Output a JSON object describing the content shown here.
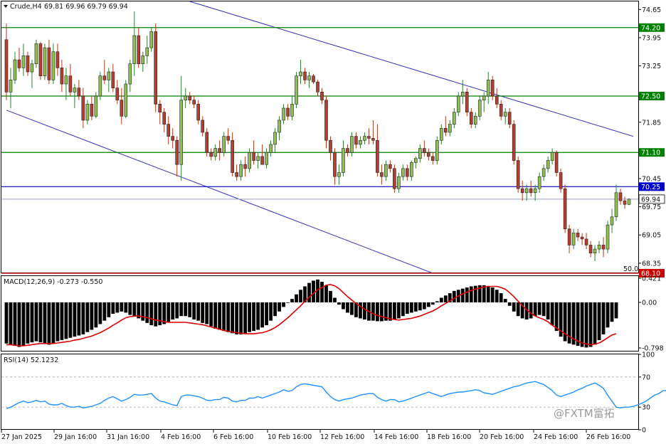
{
  "chart_data": {
    "type": "candlestick",
    "header": {
      "symbol_timeframe": "Crude,H4",
      "ohlc_text": "69.81 69.96 69.79 69.94"
    },
    "price_axis": {
      "ylim": [
        68.1,
        74.85
      ],
      "ticks": [
        "74.65",
        "73.95",
        "73.25",
        "72.50",
        "71.85",
        "71.10",
        "70.45",
        "69.75",
        "69.05",
        "68.35"
      ],
      "tick_values": [
        74.65,
        73.95,
        73.25,
        72.5,
        71.85,
        71.1,
        70.45,
        69.75,
        69.05,
        68.35
      ]
    },
    "x_labels": [
      "27 Jan 2025",
      "29 Jan 16:00",
      "31 Jan 16:00",
      "4 Feb 16:00",
      "6 Feb 16:00",
      "10 Feb 16:00",
      "12 Feb 16:00",
      "14 Feb 16:00",
      "18 Feb 16:00",
      "20 Feb 16:00",
      "24 Feb 16:00",
      "26 Feb 16:00"
    ],
    "levels": [
      {
        "value": 74.2,
        "label": "74.20",
        "color": "#008000"
      },
      {
        "value": 72.5,
        "label": "72.50",
        "color": "#008000"
      },
      {
        "value": 71.1,
        "label": "71.10",
        "color": "#008000"
      },
      {
        "value": 70.25,
        "label": "70.25",
        "color": "#0000cd"
      },
      {
        "value": 68.1,
        "label": "68.10",
        "color": "#cc0000"
      }
    ],
    "current_price": {
      "value": 69.94,
      "label": "69.94"
    },
    "fib_label": "50.0",
    "channel": {
      "color": "#3333bb",
      "upper": [
        [
          43,
          74.85
        ],
        [
          147,
          71.5
        ]
      ],
      "lower": [
        [
          0,
          72.15
        ],
        [
          100,
          68.1
        ]
      ]
    },
    "colors": {
      "up": "#2e7d32",
      "down": "#b23a1a",
      "bull_body": "#8bc34a",
      "bear_body": "#c0392b",
      "macd_bar": "#000000",
      "signal": "#dd0000",
      "rsi": "#1e90ff"
    },
    "candles": [
      [
        73.9,
        74.3,
        72.4,
        72.6
      ],
      [
        72.6,
        73.2,
        72.2,
        72.9
      ],
      [
        72.9,
        73.6,
        72.8,
        73.4
      ],
      [
        73.4,
        73.7,
        73.1,
        73.2
      ],
      [
        73.2,
        73.8,
        73.0,
        73.5
      ],
      [
        73.5,
        73.6,
        73.0,
        73.1
      ],
      [
        73.1,
        73.4,
        72.7,
        73.3
      ],
      [
        73.3,
        73.9,
        73.2,
        73.8
      ],
      [
        73.8,
        73.85,
        72.9,
        73.0
      ],
      [
        73.0,
        73.8,
        72.9,
        73.7
      ],
      [
        73.7,
        73.9,
        72.8,
        72.9
      ],
      [
        72.9,
        73.8,
        72.8,
        73.6
      ],
      [
        73.6,
        73.8,
        73.0,
        73.2
      ],
      [
        73.2,
        73.4,
        72.6,
        72.8
      ],
      [
        72.8,
        73.2,
        72.4,
        73.0
      ],
      [
        73.0,
        73.3,
        72.5,
        72.6
      ],
      [
        72.6,
        72.8,
        72.2,
        72.7
      ],
      [
        72.7,
        72.9,
        72.4,
        72.5
      ],
      [
        72.5,
        72.7,
        71.7,
        71.9
      ],
      [
        71.9,
        72.4,
        71.8,
        72.3
      ],
      [
        72.3,
        72.5,
        71.9,
        72.0
      ],
      [
        72.0,
        72.6,
        71.95,
        72.5
      ],
      [
        72.5,
        73.1,
        72.4,
        73.0
      ],
      [
        73.0,
        73.4,
        72.8,
        72.9
      ],
      [
        72.9,
        73.2,
        72.6,
        73.1
      ],
      [
        73.1,
        73.3,
        72.6,
        72.7
      ],
      [
        72.7,
        72.9,
        72.3,
        72.4
      ],
      [
        72.4,
        72.7,
        71.8,
        72.0
      ],
      [
        72.0,
        72.9,
        71.95,
        72.8
      ],
      [
        72.8,
        73.4,
        72.6,
        73.3
      ],
      [
        73.3,
        74.6,
        73.0,
        74.0
      ],
      [
        74.0,
        74.2,
        73.2,
        73.3
      ],
      [
        73.3,
        73.6,
        73.1,
        73.5
      ],
      [
        73.5,
        74.0,
        73.3,
        73.7
      ],
      [
        73.7,
        74.2,
        73.6,
        74.1
      ],
      [
        74.1,
        74.3,
        72.1,
        72.3
      ],
      [
        72.3,
        72.4,
        71.8,
        72.1
      ],
      [
        72.1,
        72.2,
        71.6,
        71.8
      ],
      [
        71.8,
        72.0,
        71.3,
        71.5
      ],
      [
        71.5,
        71.7,
        71.2,
        71.4
      ],
      [
        71.4,
        71.5,
        70.5,
        70.8
      ],
      [
        70.8,
        73.0,
        70.4,
        72.4
      ],
      [
        72.4,
        72.7,
        72.2,
        72.5
      ],
      [
        72.5,
        72.6,
        72.3,
        72.4
      ],
      [
        72.4,
        72.5,
        72.2,
        72.3
      ],
      [
        72.3,
        72.4,
        71.8,
        71.9
      ],
      [
        71.9,
        72.0,
        71.5,
        71.6
      ],
      [
        71.6,
        71.7,
        71.0,
        71.1
      ],
      [
        71.1,
        71.2,
        70.9,
        71.0
      ],
      [
        71.0,
        71.3,
        70.9,
        71.2
      ],
      [
        71.2,
        71.4,
        70.9,
        71.1
      ],
      [
        71.1,
        71.6,
        71.0,
        71.5
      ],
      [
        71.5,
        71.7,
        71.3,
        71.4
      ],
      [
        71.4,
        71.6,
        70.5,
        70.6
      ],
      [
        70.6,
        70.8,
        70.4,
        70.5
      ],
      [
        70.5,
        70.9,
        70.4,
        70.8
      ],
      [
        70.8,
        71.0,
        70.5,
        70.7
      ],
      [
        70.7,
        71.2,
        70.6,
        71.1
      ],
      [
        71.1,
        71.4,
        70.8,
        70.9
      ],
      [
        70.9,
        71.1,
        70.7,
        71.0
      ],
      [
        71.0,
        71.3,
        70.9,
        70.8
      ],
      [
        70.8,
        71.2,
        70.7,
        71.1
      ],
      [
        71.1,
        71.4,
        71.0,
        71.3
      ],
      [
        71.3,
        71.7,
        71.1,
        71.6
      ],
      [
        71.6,
        72.0,
        71.4,
        71.9
      ],
      [
        71.9,
        72.3,
        71.8,
        72.2
      ],
      [
        72.2,
        72.3,
        71.9,
        72.0
      ],
      [
        72.0,
        72.5,
        71.9,
        72.3
      ],
      [
        72.3,
        73.1,
        72.2,
        73.0
      ],
      [
        73.0,
        73.4,
        72.8,
        73.1
      ],
      [
        73.1,
        73.2,
        72.8,
        72.9
      ],
      [
        72.9,
        73.1,
        72.7,
        73.0
      ],
      [
        73.0,
        73.05,
        72.8,
        72.85
      ],
      [
        72.85,
        72.9,
        72.5,
        72.6
      ],
      [
        72.6,
        72.7,
        72.3,
        72.4
      ],
      [
        72.4,
        72.5,
        71.2,
        71.4
      ],
      [
        71.4,
        71.5,
        70.9,
        71.1
      ],
      [
        71.1,
        71.2,
        70.3,
        70.5
      ],
      [
        70.5,
        70.8,
        70.3,
        70.6
      ],
      [
        70.6,
        71.4,
        70.5,
        71.2
      ],
      [
        71.2,
        71.3,
        71.0,
        71.1
      ],
      [
        71.1,
        71.6,
        71.0,
        71.5
      ],
      [
        71.5,
        71.6,
        71.2,
        71.3
      ],
      [
        71.3,
        71.5,
        71.2,
        71.4
      ],
      [
        71.4,
        71.6,
        71.3,
        71.5
      ],
      [
        71.5,
        71.7,
        71.3,
        71.45
      ],
      [
        71.45,
        71.9,
        71.3,
        71.4
      ],
      [
        71.4,
        71.8,
        70.5,
        70.6
      ],
      [
        70.6,
        70.8,
        70.3,
        70.5
      ],
      [
        70.5,
        70.9,
        70.4,
        70.8
      ],
      [
        70.8,
        70.9,
        70.6,
        70.7
      ],
      [
        70.7,
        70.8,
        70.1,
        70.2
      ],
      [
        70.2,
        70.6,
        70.1,
        70.5
      ],
      [
        70.5,
        70.8,
        70.4,
        70.7
      ],
      [
        70.7,
        70.8,
        70.4,
        70.5
      ],
      [
        70.5,
        70.9,
        70.4,
        70.85
      ],
      [
        70.85,
        71.0,
        70.7,
        70.95
      ],
      [
        70.95,
        71.3,
        70.85,
        71.2
      ],
      [
        71.2,
        71.4,
        71.0,
        71.1
      ],
      [
        71.1,
        71.2,
        70.9,
        71.0
      ],
      [
        71.0,
        71.1,
        70.8,
        70.9
      ],
      [
        70.9,
        71.5,
        70.8,
        71.4
      ],
      [
        71.4,
        71.8,
        71.3,
        71.7
      ],
      [
        71.7,
        72.0,
        71.5,
        71.6
      ],
      [
        71.6,
        71.9,
        71.5,
        71.8
      ],
      [
        71.8,
        72.2,
        71.7,
        72.1
      ],
      [
        72.1,
        72.6,
        72.0,
        72.5
      ],
      [
        72.5,
        72.9,
        72.3,
        72.6
      ],
      [
        72.6,
        72.7,
        72.0,
        72.1
      ],
      [
        72.1,
        72.2,
        71.7,
        71.8
      ],
      [
        71.8,
        72.1,
        71.7,
        72.0
      ],
      [
        72.0,
        72.5,
        71.9,
        72.4
      ],
      [
        72.4,
        72.6,
        72.1,
        72.5
      ],
      [
        72.5,
        73.1,
        72.3,
        72.9
      ],
      [
        72.9,
        73.0,
        72.4,
        72.5
      ],
      [
        72.5,
        72.7,
        72.2,
        72.3
      ],
      [
        72.3,
        72.4,
        71.9,
        72.0
      ],
      [
        72.0,
        72.2,
        71.8,
        72.1
      ],
      [
        72.1,
        72.2,
        71.7,
        71.8
      ],
      [
        71.8,
        71.9,
        70.8,
        70.9
      ],
      [
        70.9,
        71.0,
        70.1,
        70.2
      ],
      [
        70.2,
        70.4,
        69.9,
        70.1
      ],
      [
        70.1,
        70.3,
        69.9,
        70.2
      ],
      [
        70.2,
        70.4,
        70.0,
        70.1
      ],
      [
        70.1,
        70.3,
        69.9,
        70.2
      ],
      [
        70.2,
        70.6,
        70.1,
        70.5
      ],
      [
        70.5,
        70.8,
        70.4,
        70.7
      ],
      [
        70.7,
        71.0,
        70.6,
        70.9
      ],
      [
        70.9,
        71.2,
        70.8,
        71.1
      ],
      [
        71.1,
        71.15,
        70.5,
        70.6
      ],
      [
        70.6,
        70.7,
        70.1,
        70.2
      ],
      [
        70.2,
        70.3,
        69.1,
        69.2
      ],
      [
        69.2,
        69.3,
        68.6,
        68.8
      ],
      [
        68.8,
        69.2,
        68.7,
        69.1
      ],
      [
        69.1,
        69.2,
        68.9,
        69.0
      ],
      [
        69.0,
        69.1,
        68.8,
        68.95
      ],
      [
        68.95,
        69.1,
        68.7,
        68.8
      ],
      [
        68.8,
        68.9,
        68.5,
        68.6
      ],
      [
        68.6,
        68.8,
        68.4,
        68.7
      ],
      [
        68.7,
        68.9,
        68.6,
        68.8
      ],
      [
        68.8,
        69.0,
        68.5,
        68.7
      ],
      [
        68.7,
        69.4,
        68.6,
        69.3
      ],
      [
        69.3,
        69.7,
        69.1,
        69.5
      ],
      [
        69.5,
        70.3,
        69.4,
        70.1
      ],
      [
        70.1,
        70.2,
        69.8,
        69.9
      ],
      [
        69.9,
        70.0,
        69.7,
        69.81
      ],
      [
        69.81,
        69.96,
        69.79,
        69.94
      ]
    ],
    "macd": {
      "label": "MACD(12,26,9) -0.273 -0.550",
      "ylim": [
        -0.86,
        0.46
      ],
      "ticks": [
        "0.421",
        "0.00",
        "-0.798"
      ],
      "tick_values": [
        0.421,
        0,
        -0.798
      ],
      "bars": [
        -0.72,
        -0.74,
        -0.76,
        -0.78,
        -0.76,
        -0.72,
        -0.7,
        -0.68,
        -0.7,
        -0.72,
        -0.74,
        -0.72,
        -0.68,
        -0.66,
        -0.64,
        -0.62,
        -0.6,
        -0.58,
        -0.56,
        -0.52,
        -0.48,
        -0.44,
        -0.38,
        -0.32,
        -0.26,
        -0.2,
        -0.18,
        -0.16,
        -0.18,
        -0.22,
        -0.24,
        -0.28,
        -0.32,
        -0.36,
        -0.4,
        -0.42,
        -0.4,
        -0.38,
        -0.34,
        -0.3,
        -0.28,
        -0.24,
        -0.24,
        -0.26,
        -0.3,
        -0.32,
        -0.36,
        -0.38,
        -0.42,
        -0.46,
        -0.48,
        -0.5,
        -0.52,
        -0.54,
        -0.56,
        -0.56,
        -0.54,
        -0.52,
        -0.5,
        -0.48,
        -0.44,
        -0.4,
        -0.32,
        -0.24,
        -0.16,
        -0.08,
        0.0,
        0.06,
        0.14,
        0.22,
        0.28,
        0.34,
        0.38,
        0.4,
        0.36,
        0.3,
        0.2,
        0.08,
        -0.04,
        -0.12,
        -0.18,
        -0.22,
        -0.26,
        -0.28,
        -0.3,
        -0.32,
        -0.32,
        -0.33,
        -0.33,
        -0.32,
        -0.32,
        -0.3,
        -0.28,
        -0.24,
        -0.2,
        -0.18,
        -0.16,
        -0.14,
        -0.12,
        -0.08,
        -0.04,
        0.02,
        0.08,
        0.12,
        0.16,
        0.2,
        0.22,
        0.24,
        0.26,
        0.28,
        0.29,
        0.3,
        0.3,
        0.28,
        0.26,
        0.22,
        0.16,
        0.06,
        -0.06,
        -0.16,
        -0.24,
        -0.28,
        -0.3,
        -0.28,
        -0.24,
        -0.22,
        -0.24,
        -0.3,
        -0.4,
        -0.5,
        -0.6,
        -0.68,
        -0.72,
        -0.74,
        -0.76,
        -0.78,
        -0.79,
        -0.78,
        -0.74,
        -0.66,
        -0.56,
        -0.44,
        -0.34,
        -0.28
      ],
      "signal": [
        -0.74,
        -0.74,
        -0.75,
        -0.76,
        -0.76,
        -0.75,
        -0.74,
        -0.73,
        -0.72,
        -0.72,
        -0.72,
        -0.72,
        -0.71,
        -0.7,
        -0.69,
        -0.68,
        -0.66,
        -0.65,
        -0.63,
        -0.61,
        -0.59,
        -0.56,
        -0.53,
        -0.49,
        -0.45,
        -0.4,
        -0.36,
        -0.31,
        -0.27,
        -0.25,
        -0.24,
        -0.24,
        -0.25,
        -0.27,
        -0.29,
        -0.31,
        -0.32,
        -0.34,
        -0.35,
        -0.35,
        -0.35,
        -0.35,
        -0.35,
        -0.36,
        -0.37,
        -0.38,
        -0.39,
        -0.41,
        -0.43,
        -0.45,
        -0.47,
        -0.49,
        -0.51,
        -0.52,
        -0.53,
        -0.54,
        -0.55,
        -0.55,
        -0.55,
        -0.54,
        -0.53,
        -0.51,
        -0.48,
        -0.44,
        -0.39,
        -0.33,
        -0.27,
        -0.2,
        -0.13,
        -0.06,
        0.02,
        0.09,
        0.16,
        0.22,
        0.26,
        0.3,
        0.31,
        0.29,
        0.24,
        0.17,
        0.1,
        0.04,
        -0.02,
        -0.07,
        -0.12,
        -0.16,
        -0.2,
        -0.23,
        -0.25,
        -0.27,
        -0.29,
        -0.3,
        -0.31,
        -0.3,
        -0.29,
        -0.28,
        -0.26,
        -0.24,
        -0.21,
        -0.18,
        -0.15,
        -0.11,
        -0.06,
        -0.02,
        0.03,
        0.07,
        0.11,
        0.15,
        0.18,
        0.21,
        0.23,
        0.25,
        0.27,
        0.28,
        0.28,
        0.28,
        0.26,
        0.23,
        0.17,
        0.1,
        0.02,
        -0.06,
        -0.13,
        -0.19,
        -0.24,
        -0.27,
        -0.3,
        -0.34,
        -0.4,
        -0.45,
        -0.5,
        -0.55,
        -0.6,
        -0.64,
        -0.68,
        -0.71,
        -0.73,
        -0.74,
        -0.73,
        -0.71,
        -0.67,
        -0.62,
        -0.57,
        -0.55
      ]
    },
    "rsi": {
      "label": "RSI(14) 52.1232",
      "ylim": [
        0,
        100
      ],
      "ticks": [
        "100",
        "70",
        "30",
        "0"
      ],
      "tick_values": [
        100,
        70,
        30,
        0
      ],
      "levels": [
        70,
        30
      ],
      "values": [
        28,
        30,
        33,
        36,
        38,
        36,
        37,
        39,
        37,
        38,
        34,
        33,
        33,
        35,
        32,
        30,
        30,
        31,
        29,
        30,
        31,
        33,
        35,
        39,
        42,
        44,
        41,
        38,
        40,
        43,
        47,
        46,
        46,
        47,
        48,
        42,
        38,
        37,
        35,
        33,
        32,
        44,
        46,
        46,
        45,
        44,
        42,
        39,
        39,
        40,
        40,
        43,
        42,
        38,
        37,
        39,
        39,
        42,
        42,
        44,
        42,
        44,
        46,
        48,
        50,
        53,
        51,
        52,
        57,
        60,
        61,
        60,
        59,
        58,
        57,
        50,
        44,
        40,
        38,
        40,
        41,
        42,
        44,
        46,
        47,
        48,
        48,
        43,
        40,
        38,
        40,
        40,
        37,
        38,
        40,
        42,
        44,
        46,
        48,
        50,
        48,
        46,
        44,
        46,
        48,
        49,
        50,
        50,
        51,
        52,
        53,
        52,
        49,
        48,
        47,
        49,
        51,
        53,
        55,
        57,
        58,
        60,
        62,
        63,
        64,
        62,
        60,
        56,
        52,
        46,
        44,
        46,
        48,
        50,
        53,
        55,
        58,
        60,
        62,
        59,
        55,
        46,
        38,
        30,
        29,
        30,
        30,
        31,
        33,
        35,
        38,
        42,
        46,
        48,
        52,
        52
      ]
    },
    "watermark": "@FXTM富拓"
  }
}
